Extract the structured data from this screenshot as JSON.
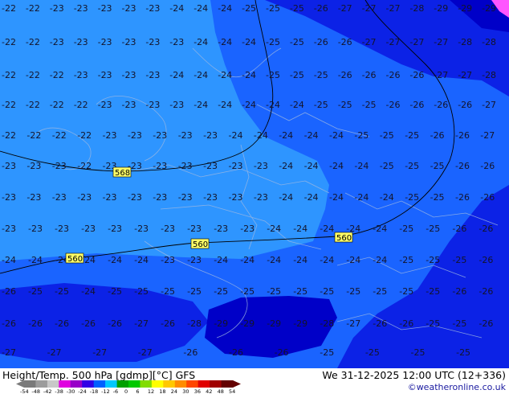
{
  "title": {
    "left": "Height/Temp. 500 hPa [gdmp][°C] GFS",
    "right": "We 31-12-2025 12:00 UTC (12+336)",
    "credit": "©weatheronline.co.uk"
  },
  "colorbar": {
    "ticks": [
      "-54",
      "-48",
      "-42",
      "-38",
      "-30",
      "-24",
      "-18",
      "-12",
      "-6",
      "0",
      "6",
      "12",
      "18",
      "24",
      "30",
      "36",
      "42",
      "48",
      "54"
    ],
    "colors": [
      "#7a7a7a",
      "#9c9c9c",
      "#c8c8c8",
      "#e000e0",
      "#9800c8",
      "#3200e6",
      "#0060ff",
      "#00c8ff",
      "#00a000",
      "#00c800",
      "#82dc00",
      "#ffff00",
      "#ffc800",
      "#ff8c00",
      "#ff4600",
      "#e00000",
      "#a00000",
      "#640000"
    ]
  },
  "colors": {
    "band_light": "#2e95ff",
    "band_mid": "#1a64ff",
    "band_dark": "#0c22e6",
    "band_darkest": "#0000c8",
    "band_pink": "#ff55ff"
  },
  "height_labels": [
    "568",
    "560",
    "560",
    "560"
  ],
  "temperature_rows": [
    [
      "-22",
      "-22",
      "-23",
      "-23",
      "-23",
      "-23",
      "-23",
      "-24",
      "-24",
      "-24",
      "-25",
      "-25",
      "-25",
      "-26",
      "-27",
      "-27",
      "-27",
      "-28",
      "-29",
      "-29",
      "-29"
    ],
    [
      "-22",
      "-22",
      "-23",
      "-23",
      "-23",
      "-23",
      "-23",
      "-23",
      "-24",
      "-24",
      "-24",
      "-25",
      "-25",
      "-26",
      "-26",
      "-27",
      "-27",
      "-27",
      "-27",
      "-28",
      "-28"
    ],
    [
      "-22",
      "-22",
      "-22",
      "-23",
      "-23",
      "-23",
      "-23",
      "-24",
      "-24",
      "-24",
      "-24",
      "-25",
      "-25",
      "-25",
      "-26",
      "-26",
      "-26",
      "-26",
      "-27",
      "-27",
      "-28"
    ],
    [
      "-22",
      "-22",
      "-22",
      "-22",
      "-23",
      "-23",
      "-23",
      "-23",
      "-24",
      "-24",
      "-24",
      "-24",
      "-24",
      "-25",
      "-25",
      "-25",
      "-26",
      "-26",
      "-26",
      "-26",
      "-27"
    ],
    [
      "-22",
      "-22",
      "-22",
      "-22",
      "-23",
      "-23",
      "-23",
      "-23",
      "-23",
      "-24",
      "-24",
      "-24",
      "-24",
      "-24",
      "-25",
      "-25",
      "-25",
      "-26",
      "-26",
      "-27"
    ],
    [
      "-23",
      "-23",
      "-23",
      "-22",
      "-23",
      "-23",
      "-23",
      "-23",
      "-23",
      "-23",
      "-23",
      "-24",
      "-24",
      "-24",
      "-24",
      "-25",
      "-25",
      "-25",
      "-26",
      "-26"
    ],
    [
      "-23",
      "-23",
      "-23",
      "-23",
      "-23",
      "-23",
      "-23",
      "-23",
      "-23",
      "-23",
      "-23",
      "-24",
      "-24",
      "-24",
      "-24",
      "-24",
      "-25",
      "-25",
      "-26",
      "-26"
    ],
    [
      "-23",
      "-23",
      "-23",
      "-23",
      "-23",
      "-23",
      "-23",
      "-23",
      "-23",
      "-23",
      "-24",
      "-24",
      "-24",
      "-24",
      "-24",
      "-25",
      "-25",
      "-26",
      "-26"
    ],
    [
      "-24",
      "-24",
      "-24",
      "-24",
      "-24",
      "-24",
      "-23",
      "-23",
      "-24",
      "-24",
      "-24",
      "-24",
      "-24",
      "-24",
      "-24",
      "-25",
      "-25",
      "-25",
      "-26"
    ],
    [
      "-26",
      "-25",
      "-25",
      "-24",
      "-25",
      "-25",
      "-25",
      "-25",
      "-25",
      "-25",
      "-25",
      "-25",
      "-25",
      "-25",
      "-25",
      "-25",
      "-25",
      "-26",
      "-26"
    ],
    [
      "-26",
      "-26",
      "-26",
      "-26",
      "-26",
      "-27",
      "-26",
      "-28",
      "-29",
      "-29",
      "-29",
      "-29",
      "-28",
      "-27",
      "-26",
      "-26",
      "-25",
      "-25",
      "-26"
    ],
    [
      "-27",
      "-27",
      "-27",
      "-27",
      "-26",
      "-26",
      "-26",
      "-25",
      "-25",
      "-25",
      "-25"
    ]
  ]
}
